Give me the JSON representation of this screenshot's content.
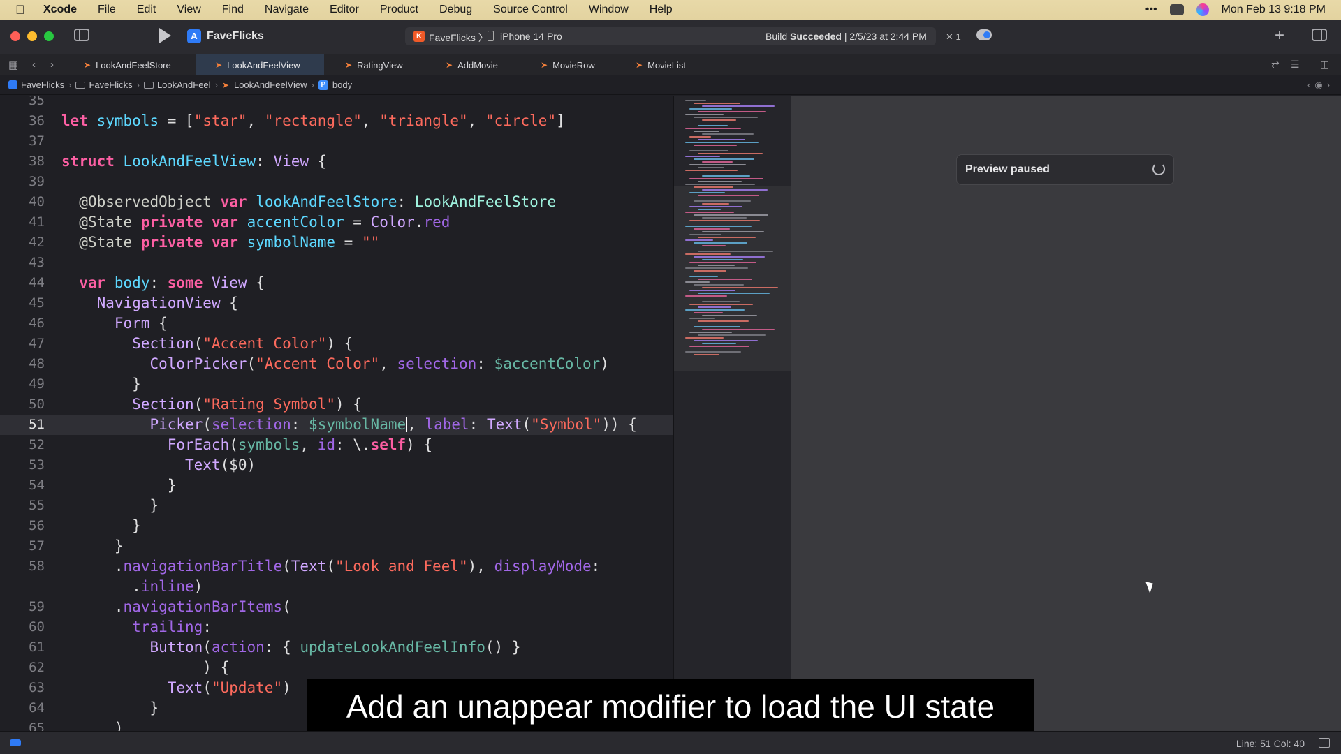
{
  "menubar": {
    "app_name": "Xcode",
    "items": [
      "File",
      "Edit",
      "View",
      "Find",
      "Navigate",
      "Editor",
      "Product",
      "Debug",
      "Source Control",
      "Window",
      "Help"
    ],
    "datetime": "Mon Feb 13  9:18 PM"
  },
  "toolbar": {
    "project_name": "FaveFlicks",
    "scheme": "FaveFlicks 〉",
    "device": "iPhone 14 Pro",
    "build_status_prefix": "Build",
    "build_status_bold": "Succeeded",
    "build_status_suffix": " | 2/5/23 at 2:44 PM",
    "error_count": "✕ 1"
  },
  "tabs": [
    {
      "label": "LookAndFeelStore",
      "active": false
    },
    {
      "label": "LookAndFeelView",
      "active": true
    },
    {
      "label": "RatingView",
      "active": false
    },
    {
      "label": "AddMovie",
      "active": false
    },
    {
      "label": "MovieRow",
      "active": false
    },
    {
      "label": "MovieList",
      "active": false
    }
  ],
  "breadcrumb": [
    "FaveFlicks",
    "FaveFlicks",
    "LookAndFeel",
    "LookAndFeelView",
    "body"
  ],
  "editor": {
    "current_line": "51",
    "lines": [
      {
        "n": "35"
      },
      {
        "n": "36"
      },
      {
        "n": "37"
      },
      {
        "n": "38"
      },
      {
        "n": "39"
      },
      {
        "n": "40"
      },
      {
        "n": "41"
      },
      {
        "n": "42"
      },
      {
        "n": "43"
      },
      {
        "n": "44"
      },
      {
        "n": "45"
      },
      {
        "n": "46"
      },
      {
        "n": "47"
      },
      {
        "n": "48"
      },
      {
        "n": "49"
      },
      {
        "n": "50"
      },
      {
        "n": "51"
      },
      {
        "n": "52"
      },
      {
        "n": "53"
      },
      {
        "n": "54"
      },
      {
        "n": "55"
      },
      {
        "n": "56"
      },
      {
        "n": "57"
      },
      {
        "n": "58"
      },
      {
        "n": ""
      },
      {
        "n": "59"
      },
      {
        "n": "60"
      },
      {
        "n": "61"
      },
      {
        "n": "62"
      },
      {
        "n": "63"
      },
      {
        "n": "64"
      },
      {
        "n": "65"
      }
    ]
  },
  "preview": {
    "status": "Preview paused"
  },
  "statusbar": {
    "cursor_position": "Line: 51  Col: 40"
  },
  "caption": "Add an unappear modifier to load the UI state",
  "colors": {
    "keyword": "#fc5fa3",
    "string": "#fc6a5d",
    "type": "#d0a8ff",
    "declaration": "#5dd8ff",
    "accent": "#2f7bf6"
  }
}
